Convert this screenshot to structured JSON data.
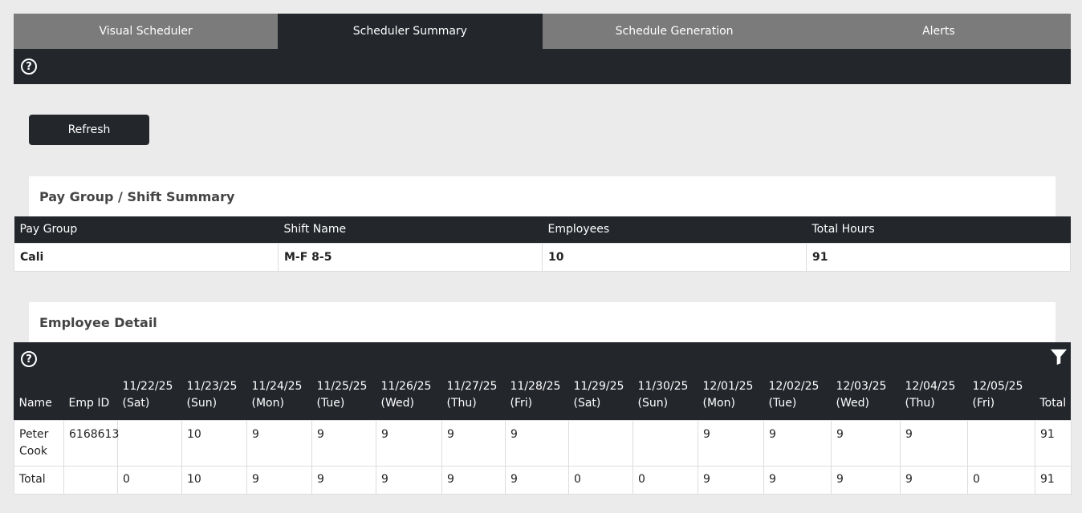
{
  "tabs": [
    {
      "label": "Visual Scheduler",
      "active": false
    },
    {
      "label": "Scheduler Summary",
      "active": true
    },
    {
      "label": "Schedule Generation",
      "active": false
    },
    {
      "label": "Alerts",
      "active": false
    }
  ],
  "help_icon_glyph": "?",
  "refresh_label": "Refresh",
  "pay_group_summary": {
    "title": "Pay Group / Shift Summary",
    "headers": [
      "Pay Group",
      "Shift Name",
      "Employees",
      "Total Hours"
    ],
    "rows": [
      [
        "Cali",
        "M-F 8-5",
        "10",
        "91"
      ]
    ]
  },
  "employee_detail": {
    "title": "Employee Detail",
    "headers": [
      {
        "line1": "",
        "line2": "Name"
      },
      {
        "line1": "",
        "line2": "Emp ID"
      },
      {
        "line1": "11/22/25",
        "line2": "(Sat)"
      },
      {
        "line1": "11/23/25",
        "line2": "(Sun)"
      },
      {
        "line1": "11/24/25",
        "line2": "(Mon)"
      },
      {
        "line1": "11/25/25",
        "line2": "(Tue)"
      },
      {
        "line1": "11/26/25",
        "line2": "(Wed)"
      },
      {
        "line1": "11/27/25",
        "line2": "(Thu)"
      },
      {
        "line1": "11/28/25",
        "line2": "(Fri)"
      },
      {
        "line1": "11/29/25",
        "line2": "(Sat)"
      },
      {
        "line1": "11/30/25",
        "line2": "(Sun)"
      },
      {
        "line1": "12/01/25",
        "line2": "(Mon)"
      },
      {
        "line1": "12/02/25",
        "line2": "(Tue)"
      },
      {
        "line1": "12/03/25",
        "line2": "(Wed)"
      },
      {
        "line1": "12/04/25",
        "line2": "(Thu)"
      },
      {
        "line1": "12/05/25",
        "line2": "(Fri)"
      },
      {
        "line1": "",
        "line2": "Total"
      }
    ],
    "rows": [
      [
        "Peter Cook",
        "6168613",
        "",
        "10",
        "9",
        "9",
        "9",
        "9",
        "9",
        "",
        "",
        "9",
        "9",
        "9",
        "9",
        "",
        "91"
      ]
    ],
    "total_row": [
      "Total",
      "",
      "0",
      "10",
      "9",
      "9",
      "9",
      "9",
      "9",
      "0",
      "0",
      "9",
      "9",
      "9",
      "9",
      "0",
      "91"
    ]
  },
  "colors": {
    "dark": "#23262b",
    "tab_inactive": "#7b7b7b",
    "background": "#ebebeb"
  }
}
